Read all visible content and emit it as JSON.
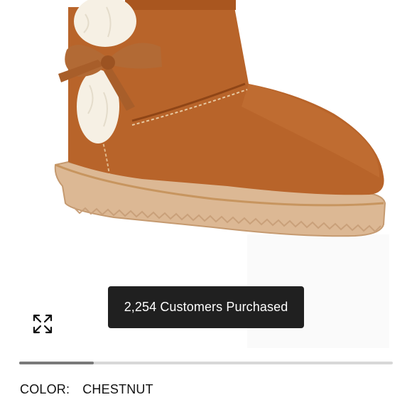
{
  "product": {
    "image_alt": "Chestnut suede boot with faux fur pom poms and bow"
  },
  "gallery": {
    "expand_icon": "expand-arrows-icon",
    "carousel_progress": 0.2
  },
  "toast": {
    "text": "2,254 Customers Purchased"
  },
  "color": {
    "label": "COLOR:",
    "value": "CHESTNUT"
  },
  "colors": {
    "suede": "#b8642a",
    "sole": "#d9b48f",
    "fur": "#f6f0e4",
    "toast_bg": "#202020",
    "progress": "#7a7a7a",
    "track": "#d8d8d8"
  }
}
